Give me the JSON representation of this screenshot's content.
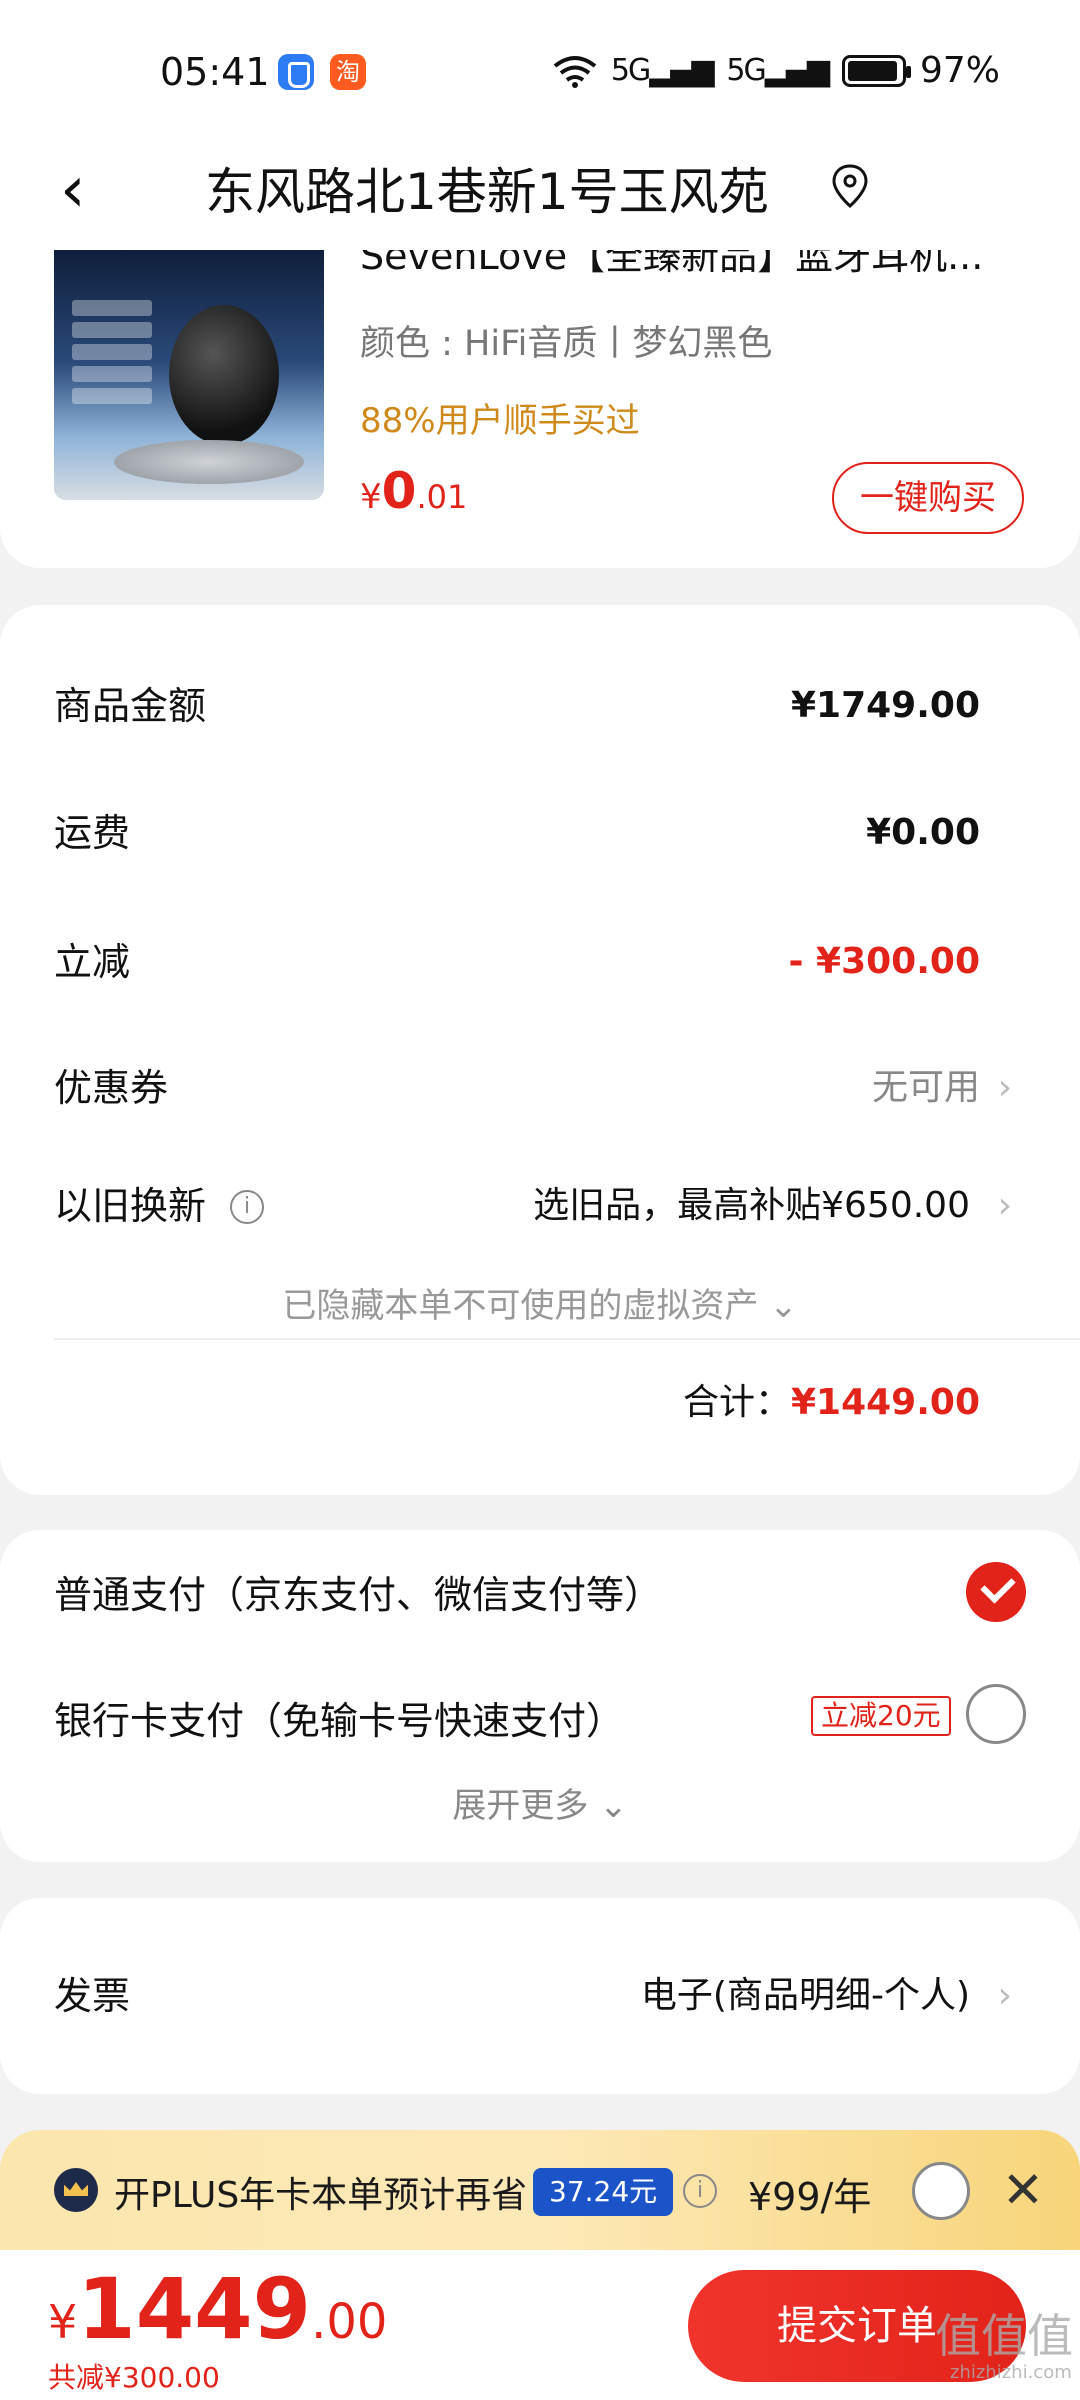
{
  "status": {
    "time": "05:41",
    "app2_glyph": "淘",
    "signal1": "5G",
    "signal2": "5G",
    "battery": "97%"
  },
  "header": {
    "title": "东风路北1巷新1号玉风苑"
  },
  "product": {
    "title": "SevenLove【全臻新品】蓝牙耳机...",
    "color": "颜色 : HiFi音质丨梦幻黑色",
    "buyers": "88%用户顺手买过",
    "price_currency": "¥",
    "price_int": "0",
    "price_dec": ".01",
    "buy_label": "一键购买"
  },
  "amounts": {
    "goods_label": "商品金额",
    "goods_value": "¥1749.00",
    "shipping_label": "运费",
    "shipping_value": "¥0.00",
    "discount_label": "立减",
    "discount_value": "- ¥300.00",
    "coupon_label": "优惠券",
    "coupon_value": "无可用",
    "tradein_label": "以旧换新",
    "tradein_value": "选旧品，最高补贴¥650.00",
    "hidden_note": "已隐藏本单不可使用的虚拟资产 ⌄",
    "total_label": "合计：",
    "total_value": "¥1449.00"
  },
  "payment": {
    "normal_label": "普通支付（京东支付、微信支付等）",
    "bank_label": "银行卡支付（免输卡号快速支付）",
    "bank_promo": "立减20元",
    "expand_label": "展开更多 ⌄"
  },
  "invoice": {
    "label": "发票",
    "value": "电子(商品明细-个人)"
  },
  "plus": {
    "text": "开PLUS年卡本单预计再省",
    "save": "37.24元",
    "price": "¥99/年"
  },
  "bottom": {
    "currency": "¥",
    "price_int": "1449",
    "price_dec": ".00",
    "discount_note": "共减¥300.00",
    "submit_label": "提交订单"
  },
  "watermark": {
    "text": "值值值",
    "sub": "zhizhizhi.com"
  },
  "colors": {
    "accent": "#e2231a",
    "buyers_orange": "#d08a1c",
    "plus_blue": "#1a54c8"
  }
}
